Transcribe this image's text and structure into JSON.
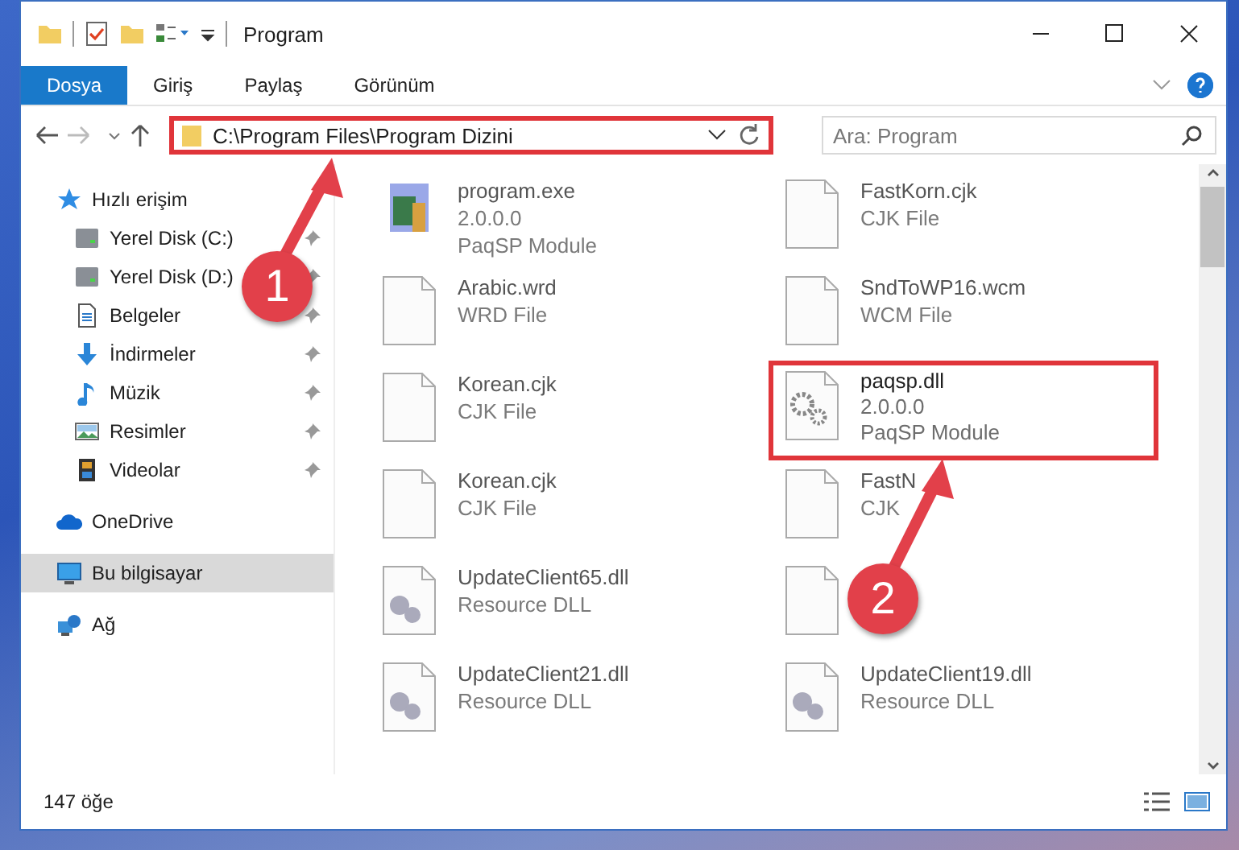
{
  "window": {
    "title": "Program"
  },
  "ribbon_tabs": [
    {
      "label": "Dosya",
      "selected": true
    },
    {
      "label": "Giriş",
      "selected": false
    },
    {
      "label": "Paylaş",
      "selected": false
    },
    {
      "label": "Görünüm",
      "selected": false
    }
  ],
  "address_bar": {
    "path": "C:\\Program Files\\Program Dizini",
    "highlighted": true
  },
  "search": {
    "placeholder": "Ara: Program"
  },
  "sidebar": {
    "items": [
      {
        "label": "Hızlı erişim",
        "kind": "star",
        "selected": false,
        "children": [
          {
            "label": "Yerel Disk (C:)",
            "kind": "drive",
            "pinned": true
          },
          {
            "label": "Yerel Disk (D:)",
            "kind": "drive",
            "pinned": true
          },
          {
            "label": "Belgeler",
            "kind": "doc",
            "pinned": true
          },
          {
            "label": "İndirmeler",
            "kind": "download",
            "pinned": true
          },
          {
            "label": "Müzik",
            "kind": "music",
            "pinned": true
          },
          {
            "label": "Resimler",
            "kind": "image",
            "pinned": true
          },
          {
            "label": "Videolar",
            "kind": "film",
            "pinned": true
          }
        ]
      },
      {
        "label": "OneDrive",
        "kind": "cloud",
        "selected": false
      },
      {
        "label": "Bu bilgisayar",
        "kind": "monitor",
        "selected": true
      },
      {
        "label": "Ağ",
        "kind": "network",
        "selected": false
      }
    ]
  },
  "files": [
    {
      "kind": "app",
      "name": "program.exe",
      "lines": [
        "2.0.0.0",
        "PaqSP Module"
      ],
      "highlighted": false
    },
    {
      "kind": "blank",
      "name": "FastKorn.cjk",
      "lines": [
        "CJK File"
      ],
      "highlighted": false
    },
    {
      "kind": "blank",
      "name": "Arabic.wrd",
      "lines": [
        "WRD File"
      ],
      "highlighted": false
    },
    {
      "kind": "blank",
      "name": "SndToWP16.wcm",
      "lines": [
        "WCM File"
      ],
      "highlighted": false
    },
    {
      "kind": "blank",
      "name": "Korean.cjk",
      "lines": [
        "CJK File"
      ],
      "highlighted": false
    },
    {
      "kind": "gear",
      "name": "paqsp.dll",
      "lines": [
        "2.0.0.0",
        "PaqSP Module"
      ],
      "highlighted": true
    },
    {
      "kind": "blank",
      "name": "Korean.cjk",
      "lines": [
        "CJK File"
      ],
      "highlighted": false
    },
    {
      "kind": "blank",
      "name": "FastN",
      "lines": [
        "CJK"
      ],
      "highlighted": false
    },
    {
      "kind": "dll",
      "name": "UpdateClient65.dll",
      "lines": [
        "Resource DLL"
      ],
      "highlighted": false
    },
    {
      "kind": "blank",
      "highlighted": false
    },
    {
      "kind": "dll",
      "name": "UpdateClient21.dll",
      "lines": [
        "Resource DLL"
      ],
      "highlighted": false
    },
    {
      "kind": "dll",
      "name": "UpdateClient19.dll",
      "lines": [
        "Resource DLL"
      ],
      "highlighted": false
    }
  ],
  "status_bar": {
    "count": "147 öğe"
  },
  "annotations": [
    {
      "number": "1"
    },
    {
      "number": "2"
    }
  ]
}
